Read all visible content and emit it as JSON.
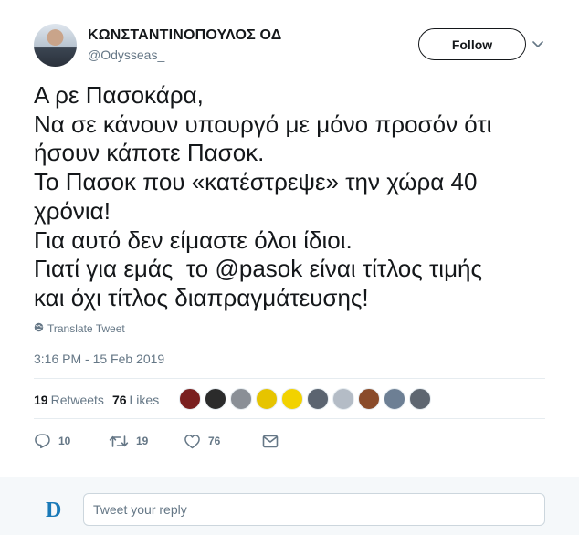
{
  "tweet": {
    "author": {
      "display_name": "ΚΩΝΣΤΑΝΤΙΝΟΠΟΥΛΟΣ ΟΔ",
      "handle": "@Odysseas_"
    },
    "follow_label": "Follow",
    "text_lines": [
      "Α ρε Πασοκάρα,",
      "Να σε κάνουν υπουργό με μόνο προσόν ότι",
      "ήσουν κάποτε Πασοκ.",
      "Το Πασοκ που «κατέστρεψε» την χώρα 40",
      "χρόνια!",
      "Για αυτό δεν είμαστε όλοι ίδιοι.",
      "Γιατί για εμάς  το ",
      "και όχι τίτλος διαπραγμάτευσης!"
    ],
    "mention": "@pasok",
    "line7_after_mention": " είναι τίτλος τιμής",
    "translate_label": "Translate Tweet",
    "timestamp": "3:16 PM - 15 Feb 2019",
    "stats": {
      "retweets_count": "19",
      "retweets_label": "Retweets",
      "likes_count": "76",
      "likes_label": "Likes"
    },
    "liker_avatar_colors": [
      "#7a1f1f",
      "#2b2b2b",
      "#8a8f96",
      "#e6c400",
      "#f2d200",
      "#5b6470",
      "#b4bcc6",
      "#8a4b2a",
      "#6d7f94",
      "#5e6670"
    ],
    "actions": {
      "reply_count": "10",
      "retweet_count": "19",
      "like_count": "76"
    }
  },
  "reply": {
    "placeholder": "Tweet your reply",
    "logo_letter": "D",
    "logo_color": "#1a7ab8"
  },
  "colors": {
    "text_primary": "#14171a",
    "text_secondary": "#657786",
    "divider": "#e6ecf0"
  }
}
